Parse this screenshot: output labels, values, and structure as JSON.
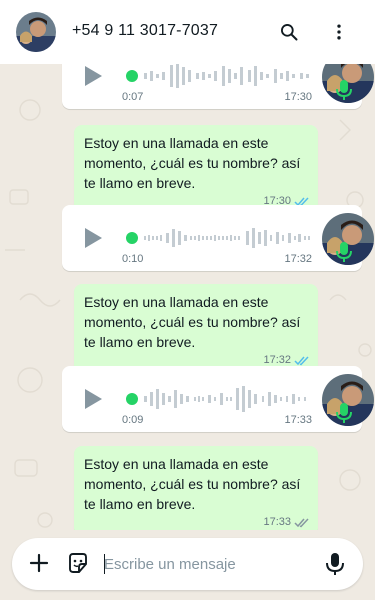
{
  "header": {
    "contact_name": "+54 9 11 3017-7037",
    "icons": [
      "avatar",
      "search-icon",
      "more-vert-icon"
    ]
  },
  "messages": [
    {
      "type": "audio",
      "duration": "0:07",
      "time": "17:30"
    },
    {
      "type": "text",
      "text": "Estoy en una llamada en este momento, ¿cuál es tu nombre? así te llamo en breve.",
      "time": "17:30",
      "status": "read"
    },
    {
      "type": "audio",
      "duration": "0:10",
      "time": "17:32"
    },
    {
      "type": "text",
      "text": "Estoy en una llamada en este momento, ¿cuál es tu nombre? así te llamo en breve.",
      "time": "17:32",
      "status": "read"
    },
    {
      "type": "audio",
      "duration": "0:09",
      "time": "17:33"
    },
    {
      "type": "text",
      "text": "Estoy en una llamada en este momento, ¿cuál es tu nombre? así te llamo en breve.",
      "time": "17:33",
      "status": "delivered"
    }
  ],
  "composer": {
    "placeholder": "Escribe un mensaje",
    "icons": [
      "plus-icon",
      "sticker-icon",
      "mic-icon"
    ]
  },
  "colors": {
    "outgoing_bubble": "#d9fdd3",
    "incoming_bubble": "#ffffff",
    "wallpaper": "#efeae2",
    "accent_green": "#25d366",
    "read_tick": "#53bdeb"
  }
}
